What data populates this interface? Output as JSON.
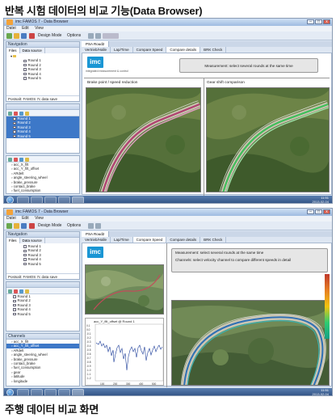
{
  "captions": {
    "top": "반복 시험 데이터의 비교 기능(Data Browser)",
    "bottom": "주행 데이터 비교 화면"
  },
  "app": {
    "title": "imc FAMOS 7 - Data Browser",
    "menu": [
      "Datei",
      "Edit",
      "View"
    ],
    "toolbar_design_mode": "Design Mode",
    "toolbar_options": "Options",
    "panel_navigation": "Navigation",
    "panel_tabs": [
      "Files",
      "Data source"
    ],
    "rounds": [
      "Round 1",
      "Round 2",
      "Round 3",
      "Round 4",
      "Round 5"
    ],
    "path_field": "Postsalt: FAMOS 7c data save",
    "panel_channels": "Channels",
    "channels": [
      "acc_X_filt",
      "acc_Y_filt_offset",
      "ARdelt",
      "angle_steering_wheel",
      "brake_pressure",
      "contact_brake",
      "fuel_consumption",
      "gear",
      "latitude",
      "longitude"
    ]
  },
  "screen1": {
    "doc_tab": "PSA Roud2",
    "tabs": [
      "Vertrieb/Halle",
      "Lap/Time",
      "Compare Speed",
      "Compare details",
      "BRK Check"
    ],
    "active_tab": 3,
    "logo_text": "imc",
    "logo_sub": "integrated measurement & control",
    "message": "Measurement: select several rounds at the same time",
    "view_left_title": "Brake point / speed reduction",
    "view_right_title": "Gear shift comparison"
  },
  "screen2": {
    "doc_tab": "PSA Roud2",
    "tabs": [
      "Vertrieb/Halle",
      "Lap/Time",
      "Compare Speed",
      "Compare details",
      "BRK Check"
    ],
    "active_tab": 2,
    "logo_text": "imc",
    "message_line1": "Measurement: select several rounds at the same time",
    "message_line2": "Channels: select velocity channel to compare different speeds in detail",
    "plot_title": "acc_Y_filt_offset @ Round 1",
    "plot_yticks": [
      "0.1",
      "0.0",
      "-0.1",
      "-0.2",
      "-0.3",
      "-0.4",
      "-0.5",
      "-0.6",
      "-0.7",
      "-0.8",
      "-0.9",
      "-1.0",
      "-1.1",
      "-1.2"
    ],
    "plot_xticks": [
      "100",
      "200",
      "300",
      "400",
      "500"
    ]
  },
  "taskbar": {
    "clock_time": "11:51",
    "clock_date": "2013-02-04"
  },
  "colors": {
    "accent": "#3d78c8",
    "taskbar": "#2c4d7f",
    "imc_blue": "#1a96d4"
  }
}
